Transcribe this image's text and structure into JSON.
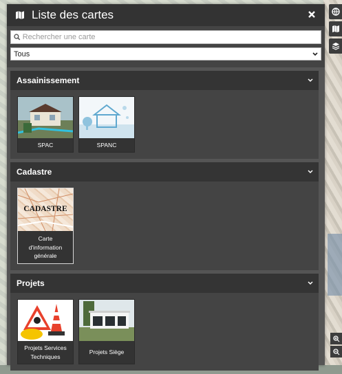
{
  "panel": {
    "title": "Liste des cartes",
    "close_icon": "close-icon",
    "search_placeholder": "Rechercher une carte",
    "filter_selected": "Tous"
  },
  "sections": [
    {
      "label": "Assainissement",
      "cards": [
        {
          "label": "SPAC"
        },
        {
          "label": "SPANC"
        }
      ]
    },
    {
      "label": "Cadastre",
      "cards": [
        {
          "label": "Carte d'information générale",
          "thumb_text": "CADASTRE"
        }
      ]
    },
    {
      "label": "Projets",
      "cards": [
        {
          "label": "Projets Services Techniques"
        },
        {
          "label": "Projets Siège"
        }
      ]
    }
  ],
  "colors": {
    "header_bg": "#333333",
    "panel_bg": "#444444",
    "section_head_bg": "#343434",
    "text": "#ffffff"
  }
}
